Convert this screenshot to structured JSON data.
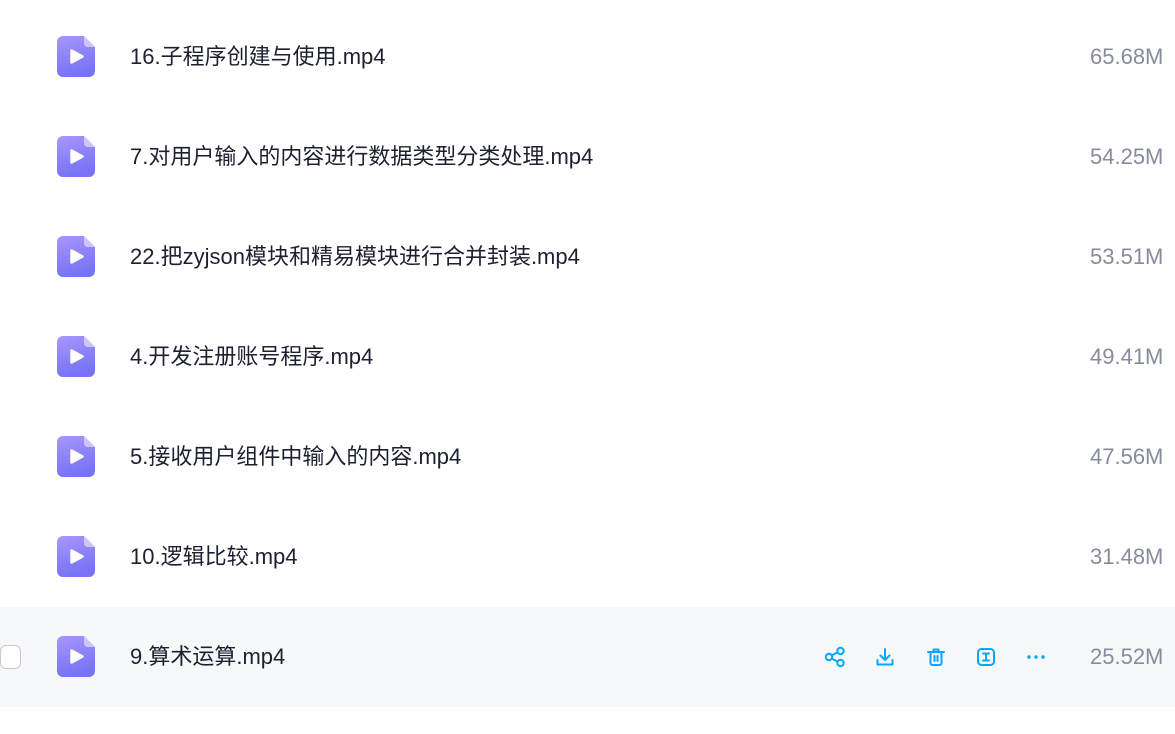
{
  "colors": {
    "accent": "#06a7ff",
    "name": "#1d2030",
    "size": "#878c9c",
    "hover_bg": "#f7f8fa",
    "video_icon_top": "#a896fc",
    "video_icon_bottom": "#7673f6"
  },
  "files": [
    {
      "name": "16.子程序创建与使用.mp4",
      "size": "65.68M",
      "icon": "video-file-icon",
      "hovered": false
    },
    {
      "name": "7.对用户输入的内容进行数据类型分类处理.mp4",
      "size": "54.25M",
      "icon": "video-file-icon",
      "hovered": false
    },
    {
      "name": "22.把zyjson模块和精易模块进行合并封装.mp4",
      "size": "53.51M",
      "icon": "video-file-icon",
      "hovered": false
    },
    {
      "name": "4.开发注册账号程序.mp4",
      "size": "49.41M",
      "icon": "video-file-icon",
      "hovered": false
    },
    {
      "name": "5.接收用户组件中输入的内容.mp4",
      "size": "47.56M",
      "icon": "video-file-icon",
      "hovered": false
    },
    {
      "name": "10.逻辑比较.mp4",
      "size": "31.48M",
      "icon": "video-file-icon",
      "hovered": false
    },
    {
      "name": "9.算术运算.mp4",
      "size": "25.52M",
      "icon": "video-file-icon",
      "hovered": true,
      "checked": false
    }
  ],
  "row_actions": [
    {
      "icon": "share-icon"
    },
    {
      "icon": "download-icon"
    },
    {
      "icon": "delete-icon"
    },
    {
      "icon": "rename-icon"
    },
    {
      "icon": "more-icon"
    }
  ]
}
